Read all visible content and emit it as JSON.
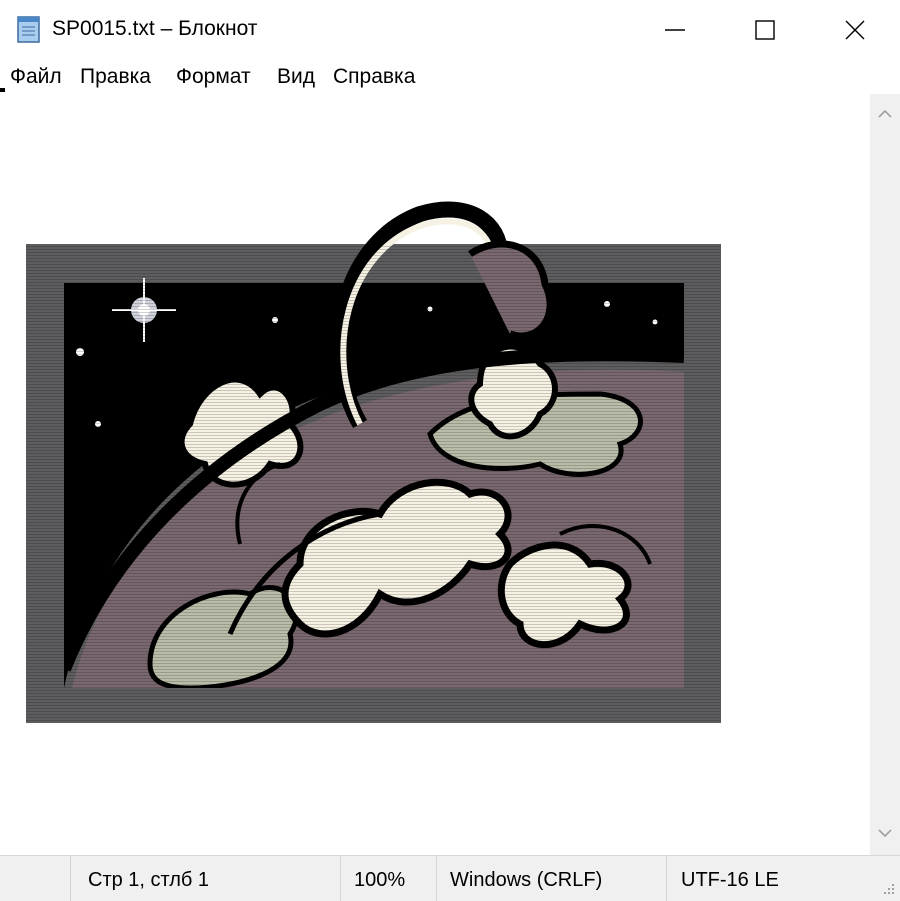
{
  "window": {
    "title": "SP0015.txt – Блокнот",
    "controls": {
      "minimize": "minimize",
      "maximize": "maximize",
      "close": "close"
    }
  },
  "menu": {
    "items": [
      "Файл",
      "Правка",
      "Формат",
      "Вид",
      "Справка"
    ]
  },
  "status": {
    "position": "Стр 1, стлб 1",
    "zoom": "100%",
    "line_endings": "Windows (CRLF)",
    "encoding": "UTF-16 LE"
  },
  "colors": {
    "frame": "#5d5d5f",
    "space": "#000000",
    "planet": "#7a6870",
    "cream": "#f6f2e3",
    "sage": "#b9bca8"
  },
  "icons": [
    "notepad-icon",
    "minimize-icon",
    "maximize-icon",
    "close-icon",
    "scroll-up-arrow-icon",
    "scroll-down-arrow-icon",
    "resize-grip-icon"
  ]
}
